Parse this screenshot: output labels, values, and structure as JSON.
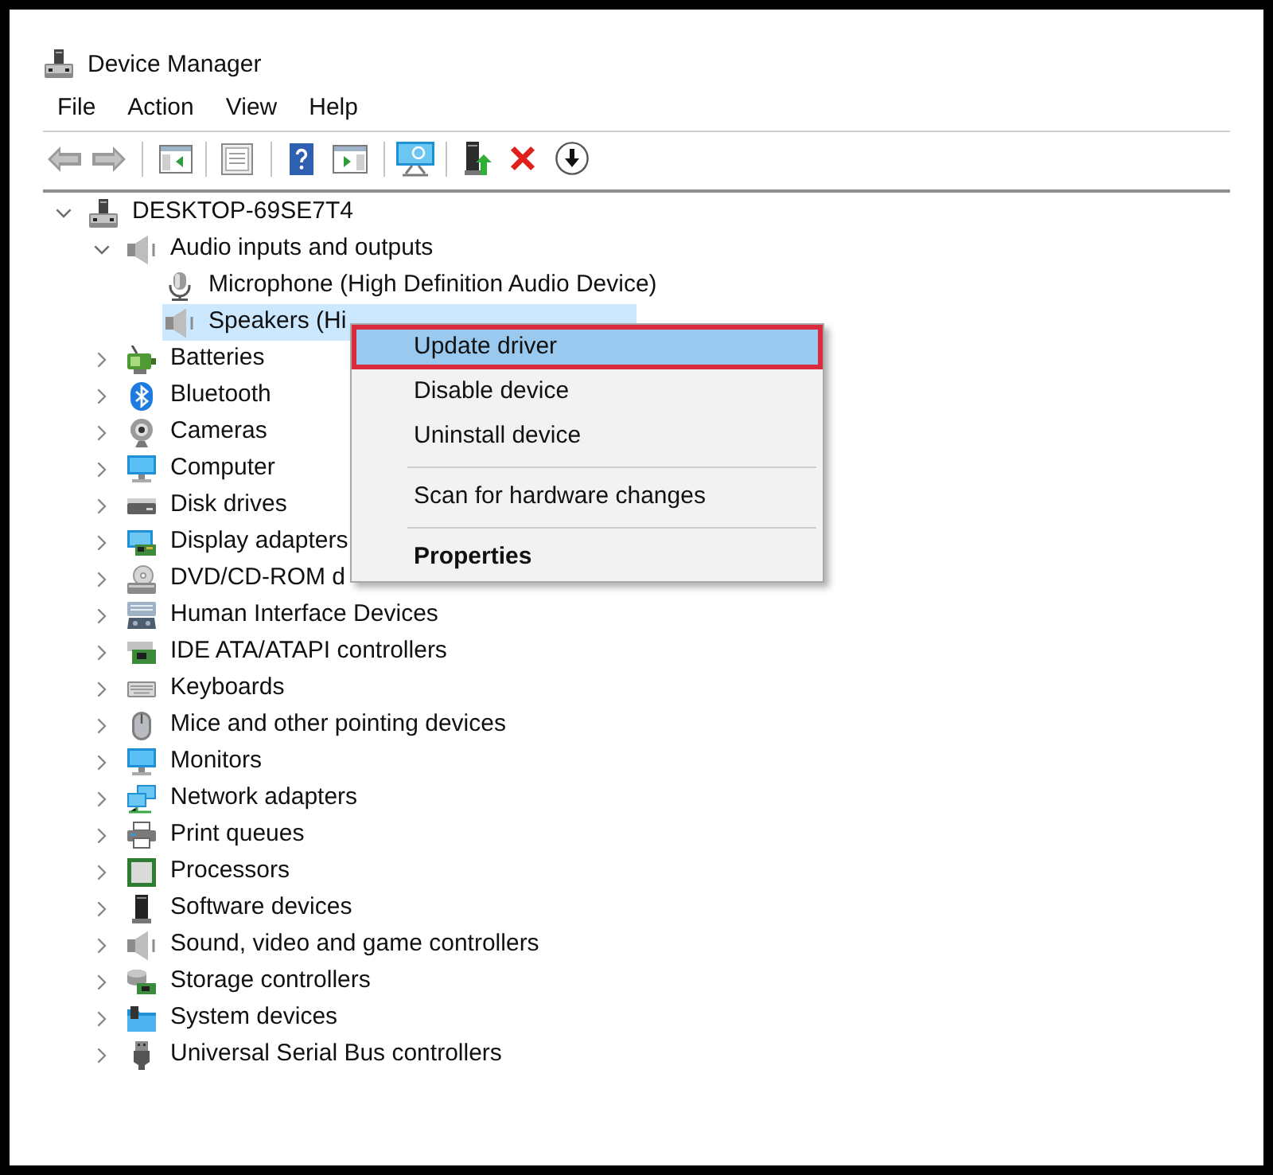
{
  "window": {
    "title": "Device Manager"
  },
  "menu_bar": [
    "File",
    "Action",
    "View",
    "Help"
  ],
  "tree": {
    "label": "DESKTOP-69SE7T4",
    "expanded": true,
    "selected": false,
    "children": [
      {
        "label": "Audio inputs and outputs",
        "expanded": true,
        "selected": false,
        "children": [
          {
            "label": "Microphone (High Definition Audio Device)",
            "selected": false
          },
          {
            "label": "Speakers (Hi",
            "selected": true
          }
        ]
      },
      {
        "label": "Batteries",
        "expanded": false,
        "selected": false
      },
      {
        "label": "Bluetooth",
        "expanded": false,
        "selected": false
      },
      {
        "label": "Cameras",
        "expanded": false,
        "selected": false
      },
      {
        "label": "Computer",
        "expanded": false,
        "selected": false
      },
      {
        "label": "Disk drives",
        "expanded": false,
        "selected": false
      },
      {
        "label": "Display adapters",
        "expanded": false,
        "selected": false
      },
      {
        "label": "DVD/CD-ROM d",
        "expanded": false,
        "selected": false
      },
      {
        "label": "Human Interface Devices",
        "expanded": false,
        "selected": false
      },
      {
        "label": "IDE ATA/ATAPI controllers",
        "expanded": false,
        "selected": false
      },
      {
        "label": "Keyboards",
        "expanded": false,
        "selected": false
      },
      {
        "label": "Mice and other pointing devices",
        "expanded": false,
        "selected": false
      },
      {
        "label": "Monitors",
        "expanded": false,
        "selected": false
      },
      {
        "label": "Network adapters",
        "expanded": false,
        "selected": false
      },
      {
        "label": "Print queues",
        "expanded": false,
        "selected": false
      },
      {
        "label": "Processors",
        "expanded": false,
        "selected": false
      },
      {
        "label": "Software devices",
        "expanded": false,
        "selected": false
      },
      {
        "label": "Sound, video and game controllers",
        "expanded": false,
        "selected": false
      },
      {
        "label": "Storage controllers",
        "expanded": false,
        "selected": false
      },
      {
        "label": "System devices",
        "expanded": false,
        "selected": false
      },
      {
        "label": "Universal Serial Bus controllers",
        "expanded": false,
        "selected": false
      }
    ]
  },
  "context_menu": {
    "items": [
      {
        "kind": "item",
        "label": "Update driver",
        "selected": true,
        "outlined": true,
        "default": false
      },
      {
        "kind": "item",
        "label": "Disable device",
        "selected": false,
        "outlined": false,
        "default": false
      },
      {
        "kind": "item",
        "label": "Uninstall device",
        "selected": false,
        "outlined": false,
        "default": false
      },
      {
        "kind": "separator"
      },
      {
        "kind": "item",
        "label": "Scan for hardware changes",
        "selected": false,
        "outlined": false,
        "default": false
      },
      {
        "kind": "separator"
      },
      {
        "kind": "item",
        "label": "Properties",
        "selected": false,
        "outlined": false,
        "default": true
      }
    ]
  }
}
